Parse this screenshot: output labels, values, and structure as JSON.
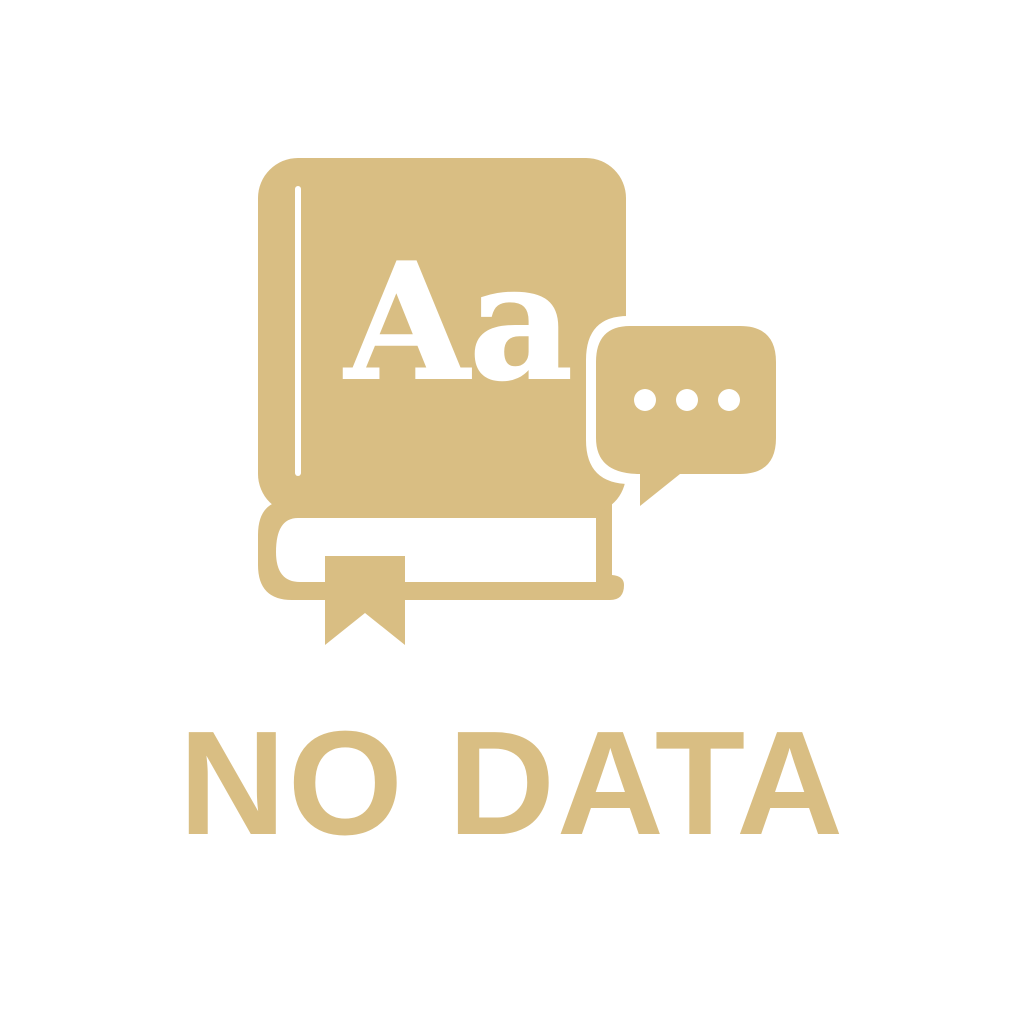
{
  "empty_state": {
    "message": "NO DATA",
    "book_glyphs": "Aa",
    "icon": "dictionary-book-chat-icon",
    "colors": {
      "accent": "#D9BE83",
      "background": "#ffffff",
      "inner": "#ffffff"
    }
  }
}
